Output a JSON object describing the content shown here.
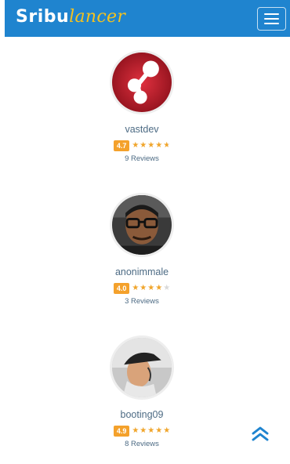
{
  "brand": {
    "part1": "Sribu",
    "part2": "lancer"
  },
  "profiles": [
    {
      "username": "vastdev",
      "rating": "4.7",
      "stars": [
        1,
        1,
        1,
        1,
        0.7
      ],
      "reviews": "9 Reviews"
    },
    {
      "username": "anonimmale",
      "rating": "4.0",
      "stars": [
        1,
        1,
        1,
        1,
        0
      ],
      "reviews": "3 Reviews"
    },
    {
      "username": "booting09",
      "rating": "4.9",
      "stars": [
        1,
        1,
        1,
        1,
        1
      ],
      "reviews": "8 Reviews"
    }
  ],
  "icons": {
    "menu": "hamburger-menu-icon",
    "back_to_top": "double-chevron-up-icon"
  },
  "colors": {
    "navbar": "#1f84cf",
    "brand_accent": "#f4c21f",
    "rating_badge": "#f4a12b",
    "star_filled": "#f0a52b",
    "star_empty": "#d9d9d9",
    "link_text": "#4d6b84"
  }
}
